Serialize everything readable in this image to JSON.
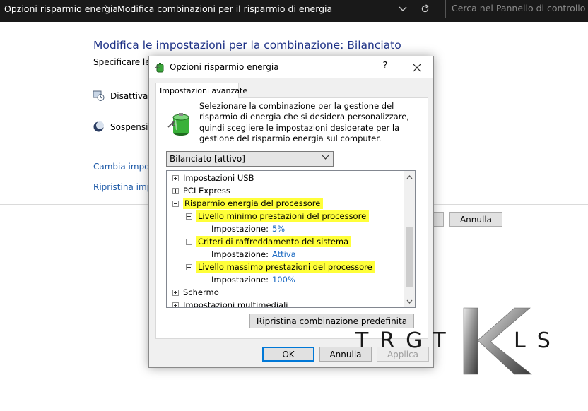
{
  "window": {
    "breadcrumb": [
      "Opzioni risparmio energia",
      "Modifica combinazioni per il risparmio di energia"
    ],
    "breadcrumb_separator": "›",
    "search_placeholder": "Cerca nel Pannello di controllo"
  },
  "background": {
    "title": "Modifica le impostazioni per la combinazione: Bilanciato",
    "subtitle": "Specificare le i",
    "rows": [
      {
        "label": "Disattivazio",
        "icon": "display-off-icon"
      },
      {
        "label": "Sospension",
        "icon": "sleep-moon-icon"
      }
    ],
    "links": [
      "Cambia impost",
      "Ripristina impo"
    ],
    "cancel_label": "Annulla"
  },
  "dialog": {
    "title": "Opzioni risparmio energia",
    "help_label": "?",
    "close_label": "✕",
    "tab_label": "Impostazioni avanzate",
    "description": "Selezionare la combinazione per la gestione del risparmio di energia che si desidera personalizzare, quindi scegliere le impostazioni desiderate per la gestione del risparmio energia sul computer.",
    "selected_plan": "Bilanciato [attivo]",
    "tree": [
      {
        "label": "Impostazioni USB",
        "expanded": false,
        "highlighted": false
      },
      {
        "label": "PCI Express",
        "expanded": false,
        "highlighted": false
      },
      {
        "label": "Risparmio energia del processore",
        "expanded": true,
        "highlighted": true
      },
      {
        "label": "Livello minimo prestazioni del processore",
        "expanded": true,
        "highlighted": true
      },
      {
        "setting_label": "Impostazione:",
        "value": "5%"
      },
      {
        "label": "Criteri di raffreddamento del sistema",
        "expanded": true,
        "highlighted": true
      },
      {
        "setting_label": "Impostazione:",
        "value": "Attiva"
      },
      {
        "label": "Livello massimo prestazioni del processore",
        "expanded": true,
        "highlighted": true
      },
      {
        "setting_label": "Impostazione:",
        "value": "100%"
      },
      {
        "label": "Schermo",
        "expanded": false,
        "highlighted": false
      },
      {
        "label": "Impostazioni multimediali",
        "expanded": false,
        "highlighted": false
      }
    ],
    "restore_label": "Ripristina combinazione predefinita",
    "ok_label": "OK",
    "cancel_label": "Annulla",
    "apply_label": "Applica"
  },
  "watermark": {
    "text_left": "TRGT",
    "text_right": "LS"
  },
  "colors": {
    "highlight": "#ffff39",
    "value_blue": "#1565c0",
    "link_blue": "#1e5aa8",
    "title_blue": "#1e3287",
    "topbar": "#191919",
    "ok_border": "#0078d7"
  }
}
